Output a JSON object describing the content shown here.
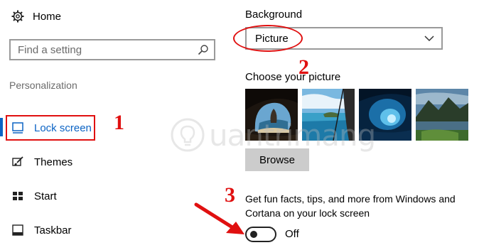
{
  "sidebar": {
    "home_label": "Home",
    "search_placeholder": "Find a setting",
    "section_label": "Personalization",
    "items": [
      {
        "label": "Lock screen"
      },
      {
        "label": "Themes"
      },
      {
        "label": "Start"
      },
      {
        "label": "Taskbar"
      }
    ]
  },
  "main": {
    "background_label": "Background",
    "background_value": "Picture",
    "choose_picture_label": "Choose your picture",
    "thumbnails": [
      "cave-beach",
      "ocean-rock",
      "ice-cave",
      "mountain-lake"
    ],
    "browse_label": "Browse",
    "fun_facts_text": "Get fun facts, tips, and more from Windows and Cortana on your lock screen",
    "toggle_state": "Off"
  },
  "annotations": {
    "step1": "1",
    "step2": "2",
    "step3": "3",
    "color": "#e01010"
  },
  "watermark": {
    "text": "uantrimang"
  },
  "colors": {
    "accent": "#0b63c4",
    "highlight": "#e01010",
    "button_bg": "#cccccc"
  }
}
